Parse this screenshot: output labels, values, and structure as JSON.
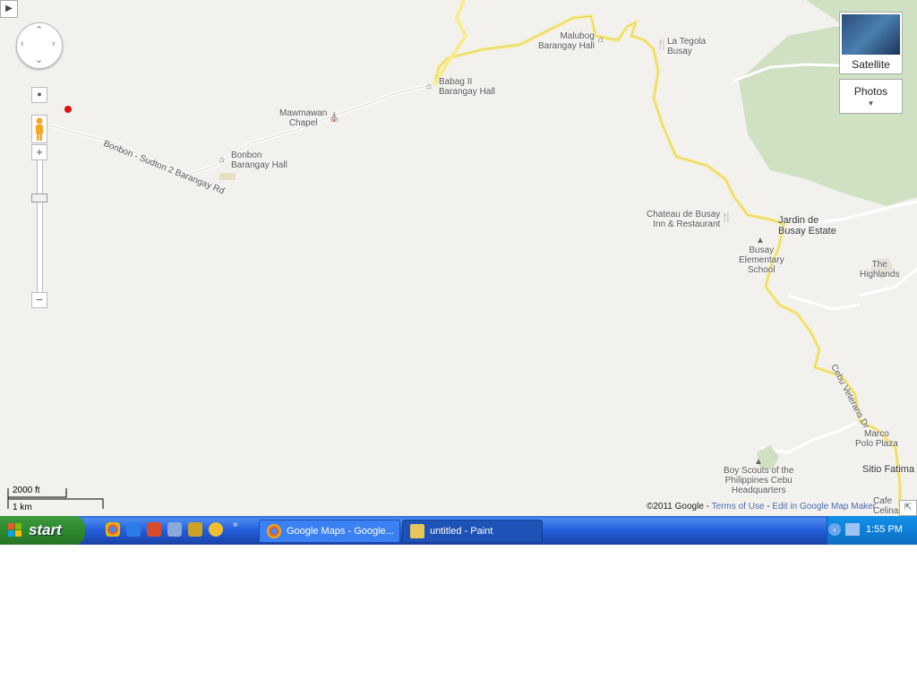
{
  "map": {
    "labels": {
      "bonbon_sudton_road": "Bonbon - Sudton 2 Barangay Rd",
      "bonbon_hall": "Bonbon\nBarangay Hall",
      "mawmawan_chapel": "Mawmawan\nChapel",
      "babag_hall": "Babag II\nBarangay Hall",
      "malubog_hall": "Malubog\nBarangay Hall",
      "la_tegola": "La Tegola\nBusay",
      "chateau": "Chateau de Busay\nInn & Restaurant",
      "jardin": "Jardin de\nBusay Estate",
      "busay_school": "Busay\nElementary\nSchool",
      "highlands": "The\nHighlands",
      "veterans_dr": "Cebu Veterans Dr",
      "marco_polo": "Marco\nPolo Plaza",
      "sitio_fatima": "Sitio Fatima",
      "boy_scouts": "Boy Scouts of the\nPhilippines Cebu\nHeadquarters",
      "cafe": "Cafe\nCelina"
    },
    "controls": {
      "satellite_label": "Satellite",
      "photos_label": "Photos",
      "zoom_in": "+",
      "zoom_out": "−"
    },
    "scale": {
      "feet": "2000 ft",
      "km": "1 km"
    },
    "copyright": {
      "text": "©2011 Google - ",
      "terms": "Terms of Use",
      "sep": " - ",
      "edit": "Edit in Google Map Maker"
    }
  },
  "taskbar": {
    "start_label": "start",
    "windows": [
      {
        "label": "Google Maps - Google...",
        "active": false
      },
      {
        "label": "untitled - Paint",
        "active": true
      }
    ],
    "clock": "1:55 PM"
  }
}
